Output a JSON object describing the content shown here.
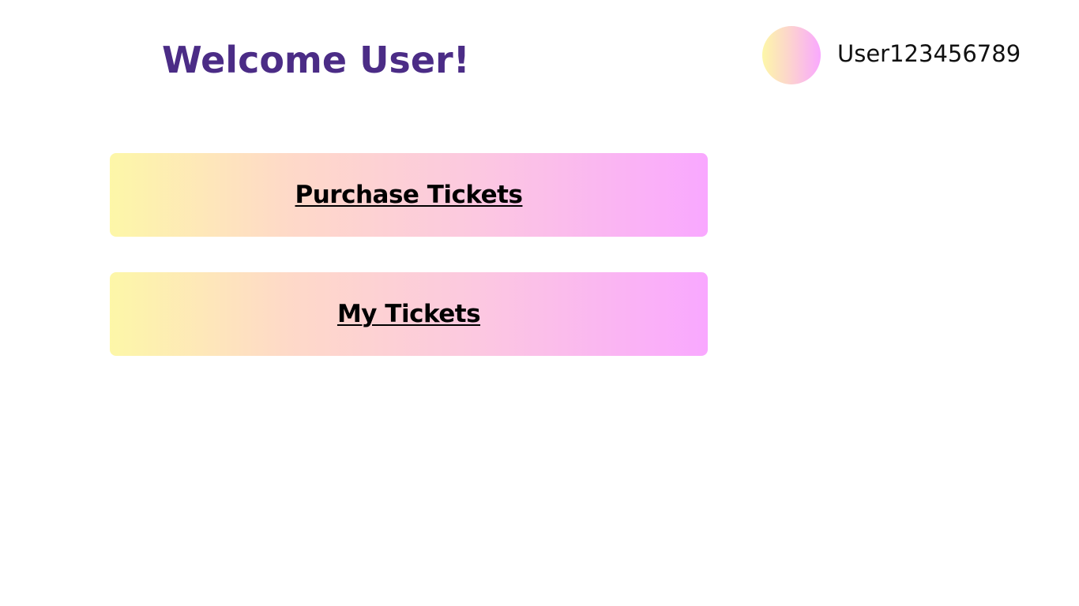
{
  "header": {
    "welcome_text": "Welcome User!",
    "username": "User123456789"
  },
  "actions": {
    "purchase_tickets_label": "Purchase Tickets",
    "my_tickets_label": "My Tickets"
  },
  "colors": {
    "title": "#4b2c86",
    "gradient_start": "#fdf7a8",
    "gradient_end": "#f9a8ff",
    "background": "#ffffff"
  }
}
